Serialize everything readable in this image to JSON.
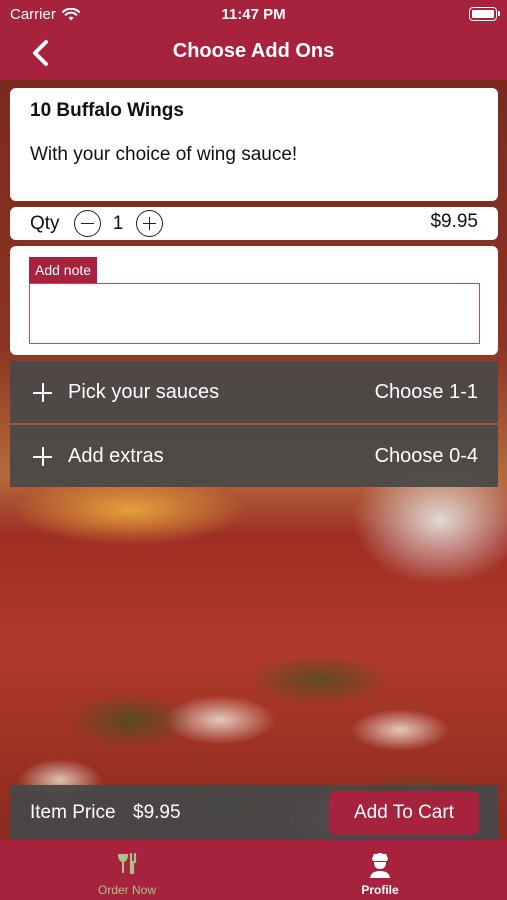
{
  "status_bar": {
    "carrier": "Carrier",
    "time": "11:47 PM",
    "icons": [
      "wifi-icon",
      "battery-icon"
    ]
  },
  "nav": {
    "title": "Choose Add Ons",
    "back_icon": "chevron-left-icon"
  },
  "item": {
    "name": "10 Buffalo Wings",
    "description": "With your choice of wing sauce!"
  },
  "quantity": {
    "label": "Qty",
    "value": "1",
    "price": "$9.95",
    "icons": [
      "minus-circle-icon",
      "plus-circle-icon"
    ]
  },
  "note": {
    "label": "Add note",
    "value": "",
    "placeholder": ""
  },
  "addon_groups": [
    {
      "title": "Pick your sauces",
      "choose": "Choose 1-1",
      "icon": "plus-icon"
    },
    {
      "title": "Add extras",
      "choose": "Choose 0-4",
      "icon": "plus-icon"
    }
  ],
  "footer": {
    "price_label": "Item Price",
    "price_value": "$9.95",
    "add_to_cart": "Add To Cart"
  },
  "tabs": [
    {
      "label": "Order Now",
      "icon": "utensils-icon"
    },
    {
      "label": "Profile",
      "icon": "chef-profile-icon"
    }
  ],
  "colors": {
    "brand": "#a6223d",
    "panel": "#484848",
    "order_tab_label": "#a8c48a"
  }
}
